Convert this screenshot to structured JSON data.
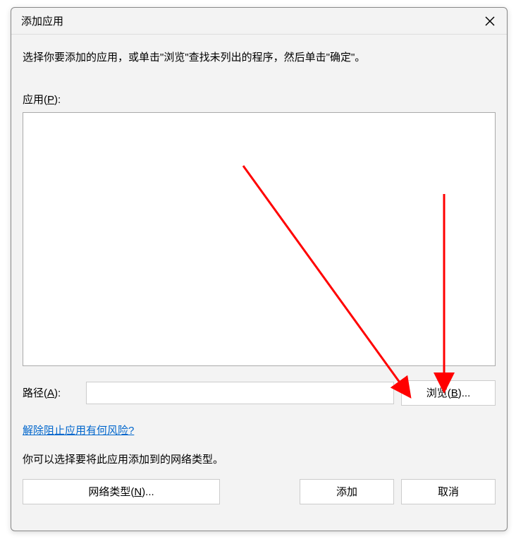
{
  "dialog": {
    "title": "添加应用",
    "instruction": "选择你要添加的应用，或单击\"浏览\"查找未列出的程序，然后单击\"确定\"。",
    "appsLabel_prefix": "应用(",
    "appsLabel_key": "P",
    "appsLabel_suffix": "):",
    "pathLabel_prefix": "路径(",
    "pathLabel_key": "A",
    "pathLabel_suffix": "):",
    "pathValue": "",
    "browseLabel_prefix": "浏览(",
    "browseLabel_key": "B",
    "browseLabel_suffix": ")...",
    "riskLink": "解除阻止应用有何风险?",
    "networkText": "你可以选择要将此应用添加到的网络类型。",
    "networkBtn_prefix": "网络类型(",
    "networkBtn_key": "N",
    "networkBtn_suffix": ")...",
    "addBtn": "添加",
    "cancelBtn": "取消"
  }
}
